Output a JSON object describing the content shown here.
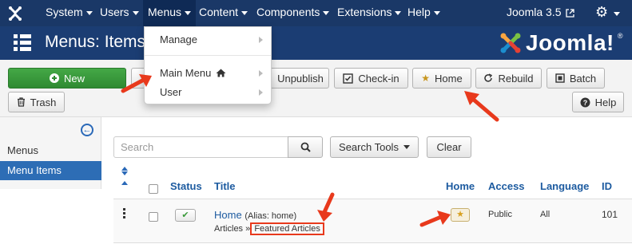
{
  "navbar": {
    "items": [
      "System",
      "Users",
      "Menus",
      "Content",
      "Components",
      "Extensions",
      "Help"
    ],
    "active": "Menus",
    "site_name": "Joomla 3.5",
    "external_icon": "external-link-icon",
    "settings_icon": "gear-icon"
  },
  "header": {
    "title": "Menus: Items",
    "logo_text": "Joomla!",
    "logo_reg": "®"
  },
  "menus_dropdown": {
    "items": [
      "Manage",
      "Main Menu",
      "User"
    ],
    "home_icon": "home-icon"
  },
  "toolbar": {
    "new": "New",
    "unpublish": "Unpublish",
    "checkin": "Check-in",
    "home": "Home",
    "rebuild": "Rebuild",
    "batch": "Batch",
    "trash": "Trash",
    "help": "Help"
  },
  "sidebar": {
    "items": [
      "Menus",
      "Menu Items"
    ],
    "active": "Menu Items"
  },
  "filters": {
    "search_placeholder": "Search",
    "search_tools": "Search Tools",
    "clear": "Clear"
  },
  "table": {
    "columns": [
      "Status",
      "Title",
      "Home",
      "Access",
      "Language",
      "ID"
    ],
    "rows": [
      {
        "title": "Home",
        "alias": "(Alias: home)",
        "type_group": "Articles",
        "type_separator": "»",
        "type": "Featured Articles",
        "status": "published",
        "home": true,
        "access": "Public",
        "language": "All",
        "id": "101"
      }
    ]
  },
  "colors": {
    "navbar": "#1a3867",
    "header": "#1b3d73",
    "primary_link": "#1d5ba0",
    "success": "#2f8a32",
    "annotation_arrow": "#e8391c"
  }
}
